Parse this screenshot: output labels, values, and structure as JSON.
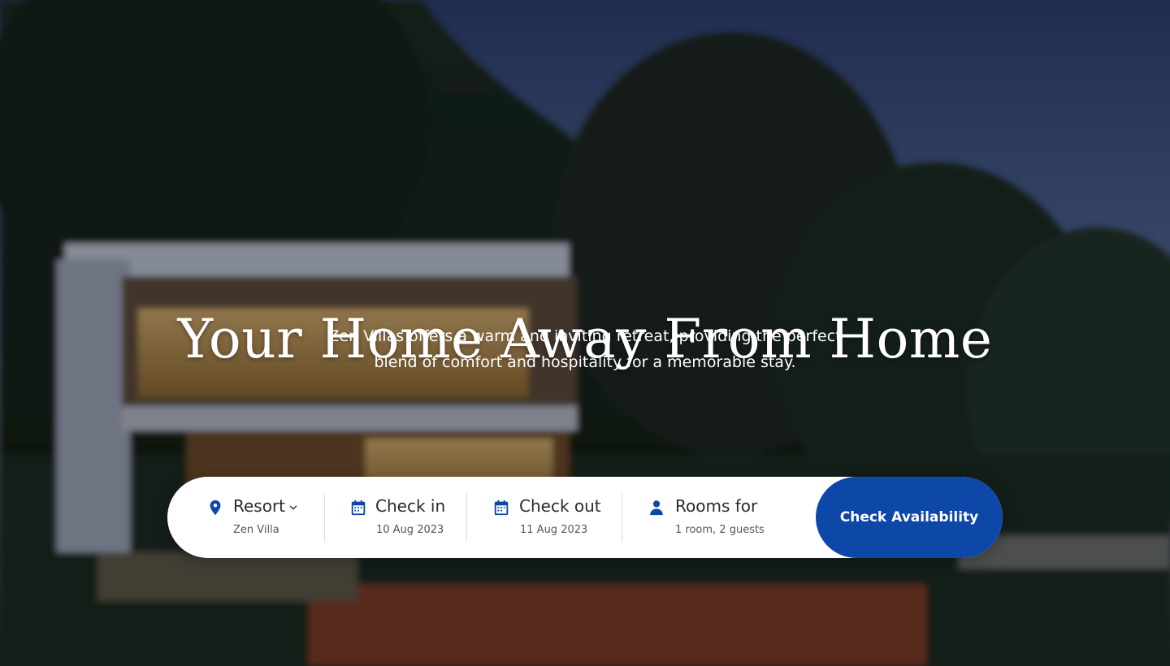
{
  "hero": {
    "headline": "Your Home Away From Home",
    "subline": "Zen Villas offers a warm and inviting retreat, providing the perfect blend of comfort and hospitality for a memorable stay."
  },
  "booking": {
    "resort": {
      "label": "Resort",
      "value": "Zen Villa",
      "icon": "location-pin-icon"
    },
    "check_in": {
      "label": "Check in",
      "value": "10 Aug 2023",
      "icon": "calendar-icon"
    },
    "check_out": {
      "label": "Check out",
      "value": "11 Aug 2023",
      "icon": "calendar-icon"
    },
    "rooms": {
      "label": "Rooms for",
      "value": "1 room, 2 guests",
      "icon": "person-icon"
    },
    "cta_label": "Check Availability"
  },
  "colors": {
    "accent": "#0d47a8",
    "icon": "#0d47a8",
    "bar_background": "#ffffff"
  }
}
